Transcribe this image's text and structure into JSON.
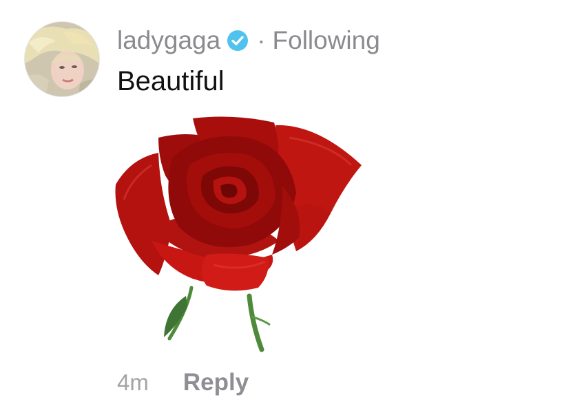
{
  "comment": {
    "username": "ladygaga",
    "separator": "·",
    "follow_status": "Following",
    "text": "Beautiful",
    "sticker": "red-rose-sticker",
    "timestamp": "4m",
    "reply_label": "Reply"
  },
  "icons": {
    "verified": "verified-badge-icon"
  },
  "colors": {
    "meta_gray": "#8a8a8f",
    "verified_blue": "#4fc3ee",
    "rose_red": "#b5120f",
    "stem_green": "#4e8a3a"
  }
}
